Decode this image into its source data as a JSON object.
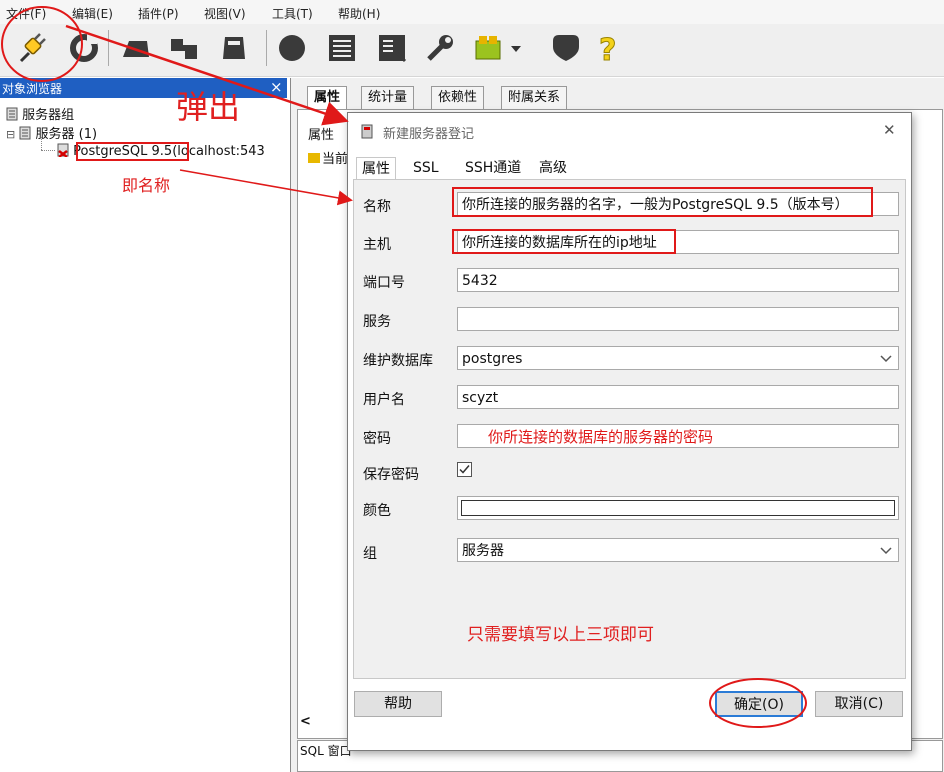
{
  "menubar": {
    "items": [
      "文件(F)",
      "编辑(E)",
      "插件(P)",
      "视图(V)",
      "工具(T)",
      "帮助(H)"
    ]
  },
  "toolbar": {
    "buttons": [
      "connect-plug-icon",
      "refresh-icon",
      "object-icon",
      "query-tool-icon",
      "delete-icon",
      "sql-icon",
      "grid-view-icon",
      "filtered-view-icon",
      "maintenance-wrench-icon",
      "plugins-icon",
      "plugin-dropdown-chevron-icon",
      "hint-icon",
      "help-icon"
    ]
  },
  "left_panel": {
    "header": "对象浏览器",
    "close": "×",
    "tree": {
      "server_group": "服务器组",
      "expander": "⊟",
      "servers": "服务器 (1)",
      "server_name": "PostgreSQL 9.5",
      "server_host": "(localhost:543"
    }
  },
  "right_panel": {
    "tabs": [
      "属性",
      "统计量",
      "依赖性",
      "附属关系"
    ],
    "sub_label": "属性",
    "current_label": "当前",
    "sql_window": "SQL 窗口",
    "scroll_left": "<"
  },
  "dialog": {
    "title": "新建服务器登记",
    "close": "✕",
    "tabs": [
      "属性",
      "SSL",
      "SSH通道",
      "高级"
    ],
    "fields": {
      "name": {
        "label": "名称",
        "value": "你所连接的服务器的名字，一般为PostgreSQL 9.5（版本号）"
      },
      "host": {
        "label": "主机",
        "value": "你所连接的数据库所在的ip地址"
      },
      "port": {
        "label": "端口号",
        "value": "5432"
      },
      "service": {
        "label": "服务",
        "value": ""
      },
      "maintenance_db": {
        "label": "维护数据库",
        "value": "postgres"
      },
      "username": {
        "label": "用户名",
        "value": "scyzt"
      },
      "password": {
        "label": "密码",
        "value": "你所连接的数据库的服务器的密码"
      },
      "save_password": {
        "label": "保存密码",
        "checked": true
      },
      "color": {
        "label": "颜色",
        "value": ""
      },
      "group": {
        "label": "组",
        "value": "服务器"
      }
    },
    "note": "只需要填写以上三项即可",
    "buttons": {
      "help": "帮助",
      "ok": "确定(O)",
      "cancel": "取消(C)"
    }
  },
  "annotations": {
    "popup": "弹出",
    "name_hint": "即名称"
  },
  "colors": {
    "annotation_red": "#e01919",
    "header_blue": "#1f5fc2",
    "ok_border": "#2b7bd6"
  }
}
